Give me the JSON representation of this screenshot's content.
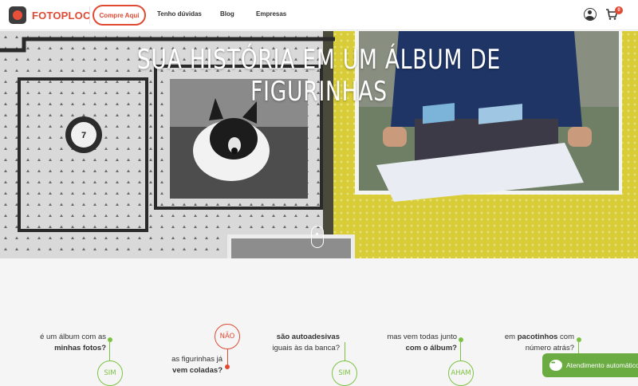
{
  "header": {
    "brand": "FOTOPLOC",
    "cta_label": "Compre Aqui",
    "nav": [
      "Tenho dúvidas",
      "Blog",
      "Empresas"
    ],
    "cart_count": "0"
  },
  "hero": {
    "title": "SUA HISTÓRIA EM UM ÁLBUM DE FIGURINHAS",
    "sticker_number": "7"
  },
  "faq": [
    {
      "q1": "é um álbum com as",
      "q2": "minhas fotos?",
      "answer": "SIM",
      "tone": "green"
    },
    {
      "q1": "as figurinhas já",
      "q2": "vem coladas?",
      "answer": "NÃO",
      "tone": "red"
    },
    {
      "q1": "são autoadesivas",
      "q2": "iguais às da banca?",
      "answer": "SIM",
      "tone": "green"
    },
    {
      "q1": "mas vem todas junto",
      "q2": "com o álbum?",
      "answer": "AHAM",
      "tone": "green"
    },
    {
      "q1": "em pacotinhos com",
      "q2": "número atrás?",
      "answer": "",
      "tone": "green"
    }
  ],
  "chat": {
    "label": "Atendimento automático"
  },
  "colors": {
    "brand": "#e04a33",
    "green": "#7cc242",
    "chat": "#6aab42"
  }
}
